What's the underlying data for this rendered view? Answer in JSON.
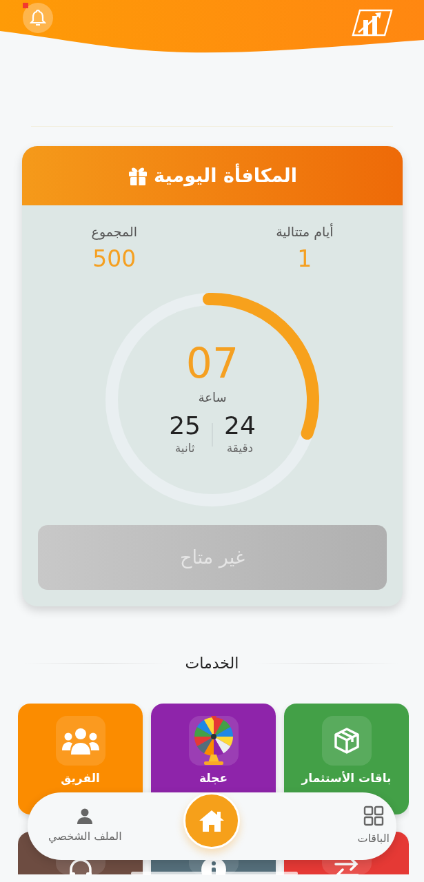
{
  "header": {
    "notification_badge": true
  },
  "reward": {
    "title": "المكافأة اليومية",
    "stats": [
      {
        "label": "أيام متتالية",
        "value": "1"
      },
      {
        "label": "المجموع",
        "value": "500"
      }
    ],
    "timer": {
      "hours": "07",
      "hours_label": "ساعة",
      "units": [
        {
          "value": "24",
          "label": "دقيقة"
        },
        {
          "value": "25",
          "label": "ثانية"
        }
      ]
    },
    "claim_button": {
      "label": "غير متاح",
      "disabled": true
    }
  },
  "services": {
    "title": "الخدمات",
    "items": [
      {
        "kind": "box",
        "label": "باقات الأستثمار",
        "color": "#43a047"
      },
      {
        "kind": "wheel",
        "label": "عجلة",
        "color": "#8e24aa"
      },
      {
        "kind": "team",
        "label": "الفريق",
        "color": "#fb8c00"
      },
      {
        "kind": "swap",
        "color": "#e53935"
      },
      {
        "kind": "info",
        "color": "#546e7a"
      },
      {
        "kind": "headphones",
        "color": "#6d4c41"
      }
    ]
  },
  "bottom_nav": [
    {
      "kind": "grid",
      "label": "الباقات",
      "selected": false
    },
    {
      "kind": "home",
      "selected": true
    },
    {
      "kind": "person",
      "label": "الملف الشخصي",
      "selected": false
    }
  ]
}
